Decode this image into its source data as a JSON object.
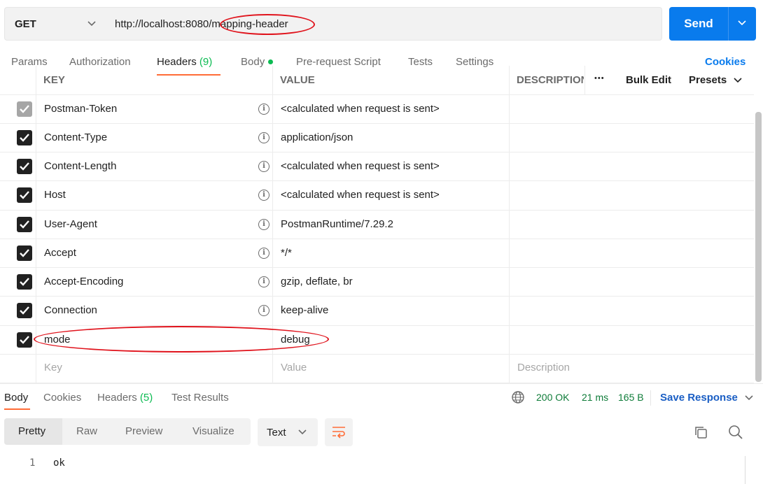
{
  "request": {
    "method": "GET",
    "url": "http://localhost:8080/mapping-header",
    "send_label": "Send"
  },
  "tabs": [
    {
      "label": "Params"
    },
    {
      "label": "Authorization"
    },
    {
      "label": "Headers",
      "count": "(9)"
    },
    {
      "label": "Body"
    },
    {
      "label": "Pre-request Script"
    },
    {
      "label": "Tests"
    },
    {
      "label": "Settings"
    }
  ],
  "cookies_label": "Cookies",
  "table": {
    "columns": [
      "KEY",
      "VALUE",
      "DESCRIPTION"
    ],
    "bulk_edit": "Bulk Edit",
    "presets": "Presets",
    "more": "•••",
    "rows": [
      {
        "key": "Postman-Token",
        "value": "<calculated when request is sent>",
        "checked": true,
        "disabled": true
      },
      {
        "key": "Content-Type",
        "value": "application/json",
        "checked": true
      },
      {
        "key": "Content-Length",
        "value": "<calculated when request is sent>",
        "checked": true
      },
      {
        "key": "Host",
        "value": "<calculated when request is sent>",
        "checked": true
      },
      {
        "key": "User-Agent",
        "value": "PostmanRuntime/7.29.2",
        "checked": true
      },
      {
        "key": "Accept",
        "value": "*/*",
        "checked": true
      },
      {
        "key": "Accept-Encoding",
        "value": "gzip, deflate, br",
        "checked": true
      },
      {
        "key": "Connection",
        "value": "keep-alive",
        "checked": true
      },
      {
        "key": "mode",
        "value": "debug",
        "checked": true
      }
    ],
    "placeholders": {
      "key": "Key",
      "value": "Value",
      "description": "Description"
    }
  },
  "response": {
    "tabs": [
      {
        "label": "Body"
      },
      {
        "label": "Cookies"
      },
      {
        "label": "Headers",
        "count": "(5)"
      },
      {
        "label": "Test Results"
      }
    ],
    "status": "200 OK",
    "time": "21 ms",
    "size": "165 B",
    "save_label": "Save Response",
    "view_modes": [
      "Pretty",
      "Raw",
      "Preview",
      "Visualize"
    ],
    "format": "Text",
    "code": [
      {
        "line": "1",
        "text": "ok"
      }
    ]
  },
  "colors": {
    "accent": "#097bed",
    "active_tab": "#ff6c37",
    "annotation": "#e0131c",
    "success": "#0cbb52"
  }
}
